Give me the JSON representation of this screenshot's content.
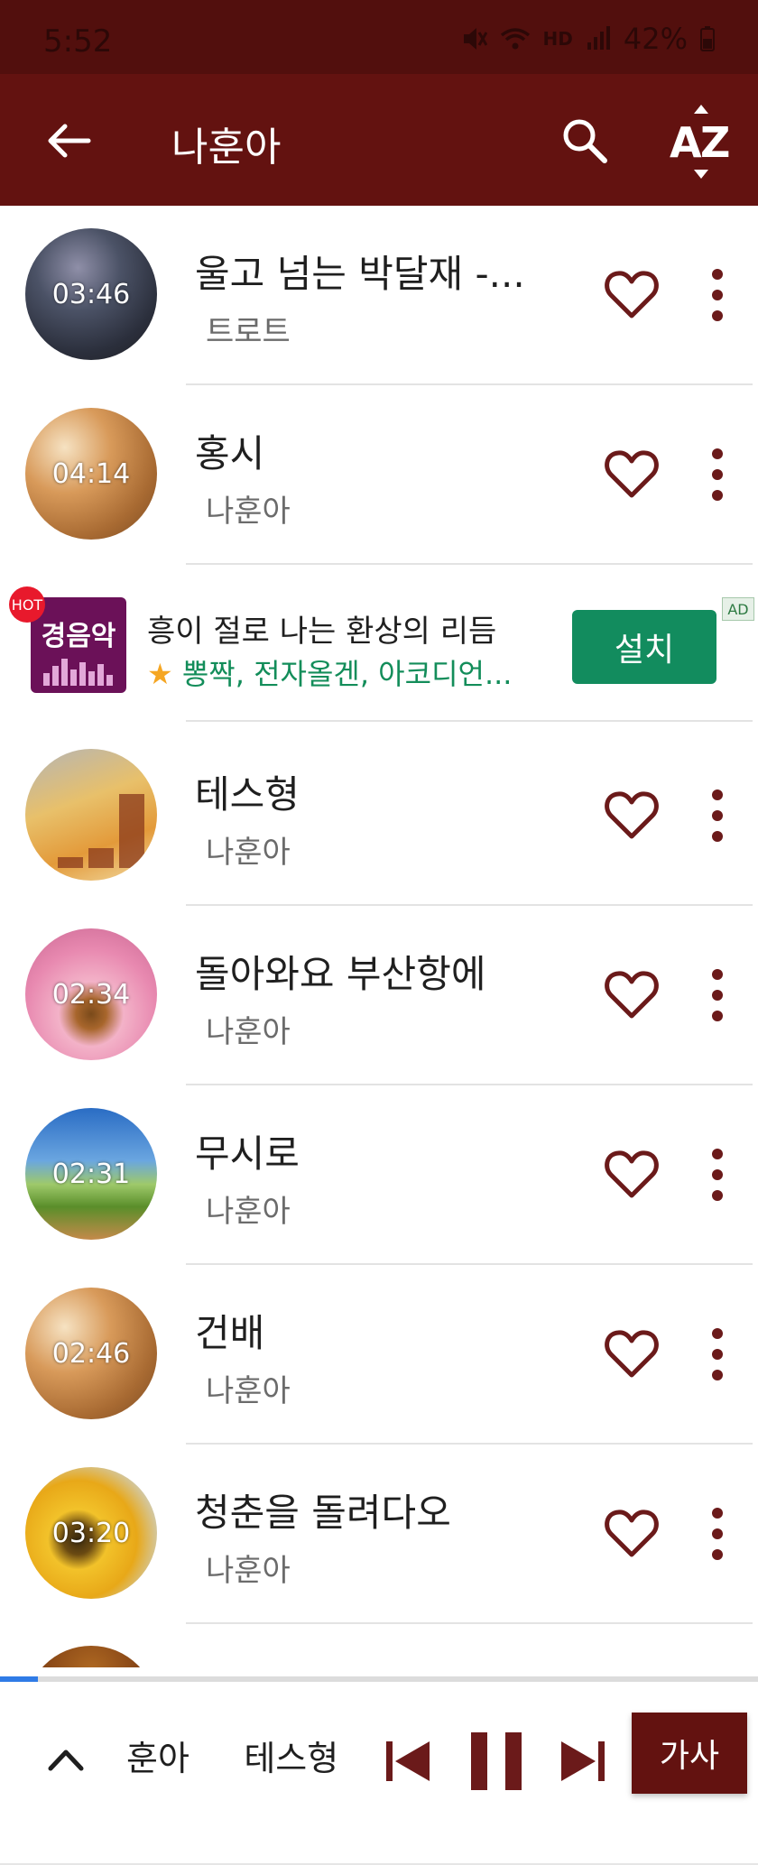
{
  "status_bar": {
    "time": "5:52",
    "battery": "42%",
    "hd_label": "HD"
  },
  "app_bar": {
    "title": "나훈아"
  },
  "songs": [
    {
      "title": "울고 넘는 박달재 -...",
      "artist": "트로트",
      "duration": "03:46"
    },
    {
      "title": "홍시",
      "artist": "나훈아",
      "duration": "04:14"
    },
    {
      "title": "테스형",
      "artist": "나훈아",
      "duration": ""
    },
    {
      "title": "돌아와요 부산항에",
      "artist": "나훈아",
      "duration": "02:34"
    },
    {
      "title": "무시로",
      "artist": "나훈아",
      "duration": "02:31"
    },
    {
      "title": "건배",
      "artist": "나훈아",
      "duration": "02:46"
    },
    {
      "title": "청춘을 돌려다오",
      "artist": "나훈아",
      "duration": "03:20"
    }
  ],
  "ad": {
    "hot": "HOT",
    "logo_text": "경음악",
    "title": "흥이 절로 나는 환상의 리듬",
    "subtitle": "뽕짝, 전자올겐, 아코디언...",
    "star": "★",
    "install": "설치",
    "badge": "AD"
  },
  "player": {
    "marquee": "훈아     테스형",
    "lyrics": "가사",
    "progress": 0.05
  },
  "colors": {
    "primary": "#631210",
    "status": "#520f0d",
    "accent": "#6b1a1a",
    "ad_green": "#128c5e"
  }
}
